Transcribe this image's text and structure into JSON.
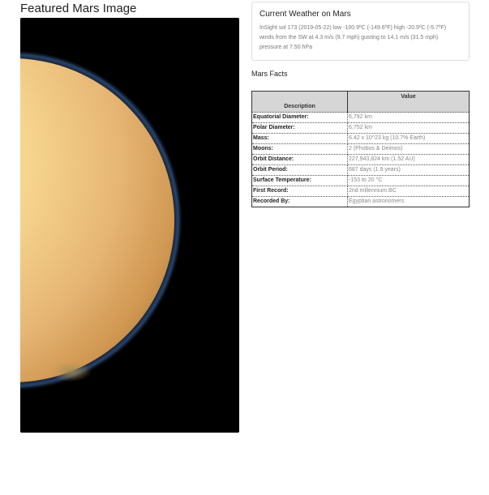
{
  "featured": {
    "title": "Featured Mars Image"
  },
  "weather": {
    "title": "Current Weather on Mars",
    "text": "InSight sol 173 (2019-05-22) low -100.9ºC (-149.6ºF) high -20.9ºC (-5.7ºF) winds from the SW at 4.3 m/s (9.7 mph) gusting to 14.1 m/s (31.5 mph) pressure at 7.50 hPa"
  },
  "facts": {
    "title": "Mars Facts",
    "header_description": "Description",
    "header_value": "Value",
    "rows": [
      {
        "label": "Equatorial Diameter:",
        "value": "6,792 km"
      },
      {
        "label": "Polar Diameter:",
        "value": "6,752 km"
      },
      {
        "label": "Mass:",
        "value": "6.42 x 10^23 kg (10.7% Earth)"
      },
      {
        "label": "Moons:",
        "value": "2 (Phobos & Deimos)"
      },
      {
        "label": "Orbit Distance:",
        "value": "227,943,824 km (1.52 AU)"
      },
      {
        "label": "Orbit Period:",
        "value": "687 days (1.9 years)"
      },
      {
        "label": "Surface Temperature:",
        "value": "-153 to 20 °C"
      },
      {
        "label": "First Record:",
        "value": "2nd millennium BC"
      },
      {
        "label": "Recorded By:",
        "value": "Egyptian astronomers"
      }
    ]
  },
  "colors": {
    "image_background": "#000000",
    "planet_light": "#f8dd8e",
    "planet_dark": "#c98a3f",
    "table_header": "#d6d6d6"
  }
}
